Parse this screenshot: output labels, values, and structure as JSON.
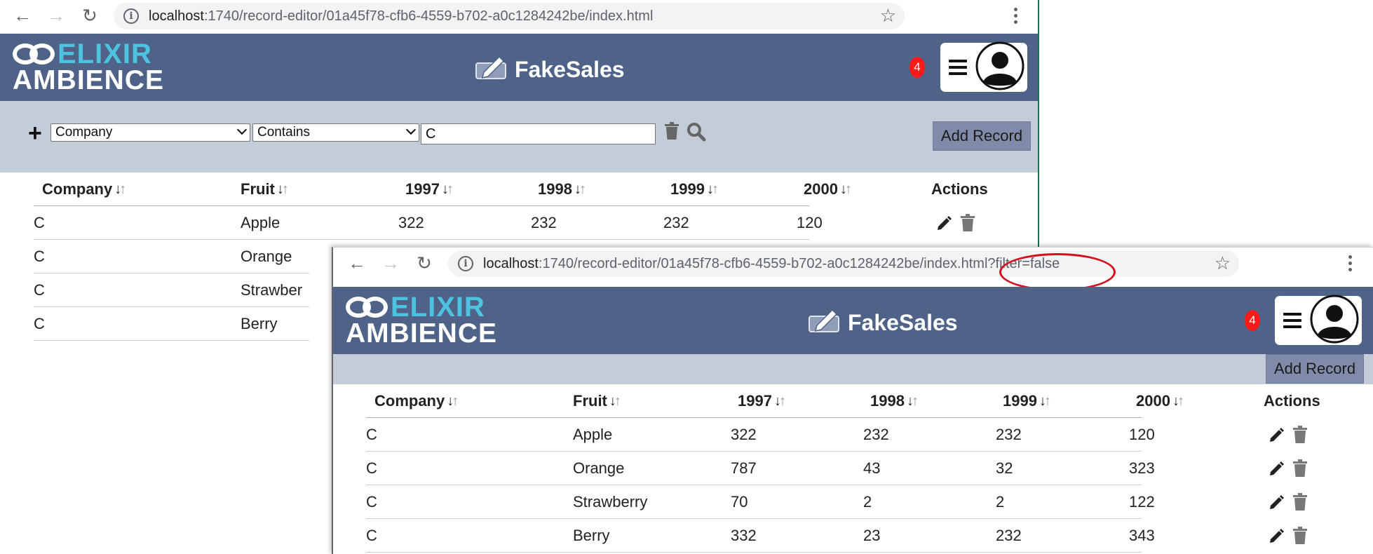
{
  "colors": {
    "header_bg": "#4f6288",
    "filter_bg": "#c4ccda",
    "accent_cyan": "#4ec3e0",
    "badge_red": "#ff1a1a",
    "add_record_bg": "#7f8ba8",
    "annotation_red": "#d40f1f"
  },
  "icons": {
    "back": "arrow-left-icon",
    "forward": "arrow-right-icon",
    "reload": "reload-icon",
    "info": "info-icon",
    "bookmark": "star-icon",
    "menu": "kebab-menu-icon",
    "title": "edit-icon",
    "add_filter": "plus-icon",
    "clear": "trash-icon",
    "search": "search-icon",
    "edit_row": "pencil-icon",
    "delete_row": "trash-icon",
    "hamburger": "hamburger-icon",
    "avatar": "user-avatar-icon"
  },
  "logo": {
    "word1": "ELIXIR",
    "word2": "AMBIENCE"
  },
  "app": {
    "title": "FakeSales",
    "notification_count": "4",
    "add_record_label": "Add Record"
  },
  "columns": [
    {
      "label": "Company"
    },
    {
      "label": "Fruit"
    },
    {
      "label": "1997"
    },
    {
      "label": "1998"
    },
    {
      "label": "1999"
    },
    {
      "label": "2000"
    },
    {
      "label": "Actions"
    }
  ],
  "window1": {
    "url_host": "localhost",
    "url_rest": ":1740/record-editor/01a45f78-cfb6-4559-b702-a0c1284242be/index.html",
    "filter": {
      "field": "Company",
      "operator": "Contains",
      "value": "C"
    },
    "rows": [
      {
        "company": "C",
        "fruit": "Apple",
        "y1997": "322",
        "y1998": "232",
        "y1999": "232",
        "y2000": "120"
      },
      {
        "company": "C",
        "fruit": "Orange"
      },
      {
        "company": "C",
        "fruit": "Strawber"
      },
      {
        "company": "C",
        "fruit": "Berry"
      }
    ]
  },
  "window2": {
    "url_host": "localhost",
    "url_rest": ":1740/record-editor/01a45f78-cfb6-4559-b702-a0c1284242be/index.html?filter=false",
    "rows": [
      {
        "company": "C",
        "fruit": "Apple",
        "y1997": "322",
        "y1998": "232",
        "y1999": "232",
        "y2000": "120"
      },
      {
        "company": "C",
        "fruit": "Orange",
        "y1997": "787",
        "y1998": "43",
        "y1999": "32",
        "y2000": "323"
      },
      {
        "company": "C",
        "fruit": "Strawberry",
        "y1997": "70",
        "y1998": "2",
        "y1999": "2",
        "y2000": "122"
      },
      {
        "company": "C",
        "fruit": "Berry",
        "y1997": "332",
        "y1998": "23",
        "y1999": "232",
        "y2000": "343"
      }
    ]
  }
}
